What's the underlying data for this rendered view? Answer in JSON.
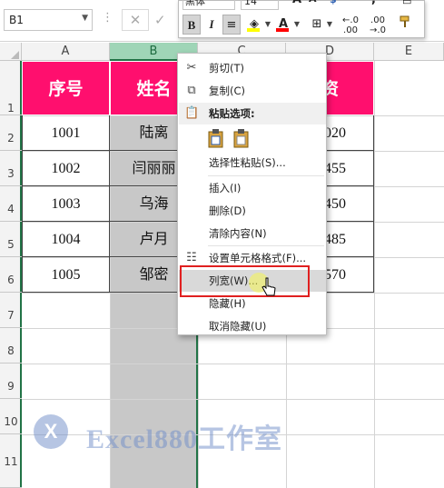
{
  "formula_bar": {
    "name_box": "B1",
    "cancel_symbol": "✕",
    "enter_symbol": "✓"
  },
  "mini_toolbar": {
    "font_name": "黑体",
    "font_size": "14",
    "grow_font": "A",
    "shrink_font": "A",
    "bold": "B",
    "italic": "I",
    "font_color_letter": "A",
    "increase_decimal": "←.0 .00",
    "decrease_decimal": ".00 →.0",
    "comma_style": ","
  },
  "columns": [
    "A",
    "B",
    "C",
    "D",
    "E"
  ],
  "rows": [
    "1",
    "2",
    "3",
    "4",
    "5",
    "6",
    "7",
    "8",
    "9",
    "10",
    "11"
  ],
  "table": {
    "headers": [
      "序号",
      "姓名",
      "",
      "资"
    ],
    "ids": [
      "1001",
      "1002",
      "1003",
      "1004",
      "1005"
    ],
    "names": [
      "陆离",
      "闫丽丽",
      "乌海",
      "卢月",
      "邹密"
    ],
    "d_values": [
      "020",
      "455",
      "450",
      "485",
      "570"
    ]
  },
  "context_menu": {
    "cut": "剪切(T)",
    "copy": "复制(C)",
    "paste_options": "粘贴选项:",
    "paste_special": "选择性粘贴(S)...",
    "insert": "插入(I)",
    "delete": "删除(D)",
    "clear_contents": "清除内容(N)",
    "format_cells": "设置单元格格式(F)...",
    "column_width": "列宽(W)...",
    "hide": "隐藏(H)",
    "unhide": "取消隐藏(U)"
  },
  "watermark": {
    "badge": "X",
    "text": "Excel880工作室"
  },
  "colors": {
    "header_fill": "#ff0f6e",
    "selected_column": "#c8c8c8",
    "excel_green": "#217346",
    "highlight_box": "#e02020"
  }
}
